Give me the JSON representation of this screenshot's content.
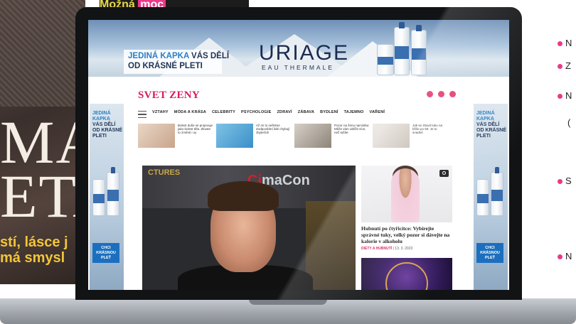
{
  "background": {
    "magazine_title": [
      "Možná",
      "moc"
    ],
    "big_letters": [
      "MA",
      "ETA"
    ],
    "yellow_lines": [
      "stí, lásce j",
      "má smysl"
    ],
    "right_bullets": [
      "N",
      "Z",
      "N",
      "(",
      "S",
      "N"
    ],
    "colors": {
      "accent_pink": "#e93a87",
      "yellow": "#f3c53a"
    }
  },
  "ad_banner": {
    "tagline_prefix": "JEDINÁ KAPKA",
    "tagline_suffix": " VÁS DĚLÍ",
    "tagline_line2": "OD KRÁSNÉ PLETI",
    "brand": "URIAGE",
    "brand_sub": "EAU THERMALE"
  },
  "side_ad": {
    "prefix": "JEDINÁ KAPKA",
    "line2": "VÁS DĚLÍ",
    "line3": "OD KRÁSNÉ",
    "line4": "PLETI",
    "cta": "CHCI KRÁSNOU PLEŤ"
  },
  "site": {
    "logo": "SVET ZENY",
    "nav": [
      "VZTAHY",
      "MÓDA A KRÁSA",
      "CELEBRITY",
      "PSYCHOLOGIE",
      "ZDRAVÍ",
      "ZÁBAVA",
      "BYDLENÍ",
      "TAJEMNO",
      "VAŘENÍ"
    ],
    "teasers": [
      {
        "text": "Bolest duše se projevuje jako bolest těla. Zkuste to změnit i vy"
      },
      {
        "text": "Až mi to neřekne Zodpovědní lidé chybují zbytečně"
      },
      {
        "text": "Pozor na ženu narcistku: Může vám ublížit více, než tušíte"
      },
      {
        "text": "Jak se zbavit tuku na břiše po 50: Je to snadné"
      }
    ],
    "hero": {
      "backdrop_text": "maCon",
      "backdrop_prefix": "Ci",
      "corner_text": "CTURES"
    },
    "side_card": {
      "title": "Hubnutí po čtyřicítce: Vybírejte správné tuky, velký pozor si dávejte na kalorie v alkoholu",
      "category": "DIETY A HUBNUTÍ",
      "separator": " | ",
      "date": "13. 3. 2023"
    }
  }
}
